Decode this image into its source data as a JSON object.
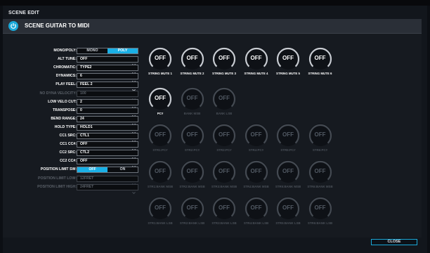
{
  "window_title": "SCENE EDIT",
  "header_title": "SCENE GUITAR TO MIDI",
  "params": [
    {
      "label": "MONO/POLY:",
      "type": "toggle",
      "options": [
        "MONO",
        "POLY"
      ],
      "selected": 1,
      "dim": false
    },
    {
      "label": "ALT TUNE:",
      "value": "OFF",
      "dim": false
    },
    {
      "label": "CHROMATIC:",
      "value": "TYPE2",
      "dim": false
    },
    {
      "label": "DYNAMICS:",
      "value": "6",
      "dim": false
    },
    {
      "label": "PLAY FEEL:",
      "value": "FEEL 2",
      "dim": false
    },
    {
      "label": "NO DYNA VELOCITY:",
      "value": "100",
      "dim": true
    },
    {
      "label": "LOW VELO CUT:",
      "value": "2",
      "dim": false
    },
    {
      "label": "TRANSPOSE:",
      "value": "0",
      "dim": false
    },
    {
      "label": "BEND RANGE:",
      "value": "24",
      "dim": false
    },
    {
      "label": "HOLD TYPE:",
      "value": "HOLD1",
      "dim": false
    },
    {
      "label": "CC1 SRC:",
      "value": "CTL1",
      "dim": false
    },
    {
      "label": "CC1 CC#:",
      "value": "OFF",
      "dim": false
    },
    {
      "label": "CC2 SRC:",
      "value": "CTL2",
      "dim": false
    },
    {
      "label": "CC2 CC#:",
      "value": "OFF",
      "dim": false
    },
    {
      "label": "POSITION LIMIT SW:",
      "type": "toggle",
      "options": [
        "OFF",
        "ON"
      ],
      "selected": 0,
      "dim": false
    },
    {
      "label": "POSITION LIMIT LOW:",
      "value": "12FRET",
      "dim": true
    },
    {
      "label": "POSITION LIMIT HIGH:",
      "value": "24FRET",
      "dim": true
    }
  ],
  "knob_rows": [
    [
      {
        "value": "OFF",
        "label": "STRING MUTE 1",
        "dim": false
      },
      {
        "value": "OFF",
        "label": "STRING MUTE 2",
        "dim": false
      },
      {
        "value": "OFF",
        "label": "STRING MUTE 3",
        "dim": false
      },
      {
        "value": "OFF",
        "label": "STRING MUTE 4",
        "dim": false
      },
      {
        "value": "OFF",
        "label": "STRING MUTE 5",
        "dim": false
      },
      {
        "value": "OFF",
        "label": "STRING MUTE 6",
        "dim": false
      }
    ],
    [
      {
        "value": "OFF",
        "label": "PC#",
        "dim": false
      },
      {
        "value": "OFF",
        "label": "BANK MSB",
        "dim": true
      },
      {
        "value": "OFF",
        "label": "BANK LSB",
        "dim": true
      }
    ],
    [
      {
        "value": "OFF",
        "label": "STR1:PC#",
        "dim": true
      },
      {
        "value": "OFF",
        "label": "STR2:PC#",
        "dim": true
      },
      {
        "value": "OFF",
        "label": "STR3:PC#",
        "dim": true
      },
      {
        "value": "OFF",
        "label": "STR4:PC#",
        "dim": true
      },
      {
        "value": "OFF",
        "label": "STR5:PC#",
        "dim": true
      },
      {
        "value": "OFF",
        "label": "STR6:PC#",
        "dim": true
      }
    ],
    [
      {
        "value": "OFF",
        "label": "STR1:BANK MSB",
        "dim": true
      },
      {
        "value": "OFF",
        "label": "STR2:BANK MSB",
        "dim": true
      },
      {
        "value": "OFF",
        "label": "STR3:BANK MSB",
        "dim": true
      },
      {
        "value": "OFF",
        "label": "STR4:BANK MSB",
        "dim": true
      },
      {
        "value": "OFF",
        "label": "STR5:BANK MSB",
        "dim": true
      },
      {
        "value": "OFF",
        "label": "STR6:BANK MSB",
        "dim": true
      }
    ],
    [
      {
        "value": "OFF",
        "label": "STR1:BANK LSB",
        "dim": true
      },
      {
        "value": "OFF",
        "label": "STR2:BANK LSB",
        "dim": true
      },
      {
        "value": "OFF",
        "label": "STR3:BANK LSB",
        "dim": true
      },
      {
        "value": "OFF",
        "label": "STR4:BANK LSB",
        "dim": true
      },
      {
        "value": "OFF",
        "label": "STR5:BANK LSB",
        "dim": true
      },
      {
        "value": "OFF",
        "label": "STR6:BANK LSB",
        "dim": true
      }
    ]
  ],
  "close_label": "CLOSE",
  "colors": {
    "accent": "#1ab0e6",
    "knob_ring": "#c8ccd2",
    "knob_ring_dim": "#444a52"
  },
  "icons": {
    "header": "power-icon",
    "dropdown": "chevron-down-icon"
  }
}
